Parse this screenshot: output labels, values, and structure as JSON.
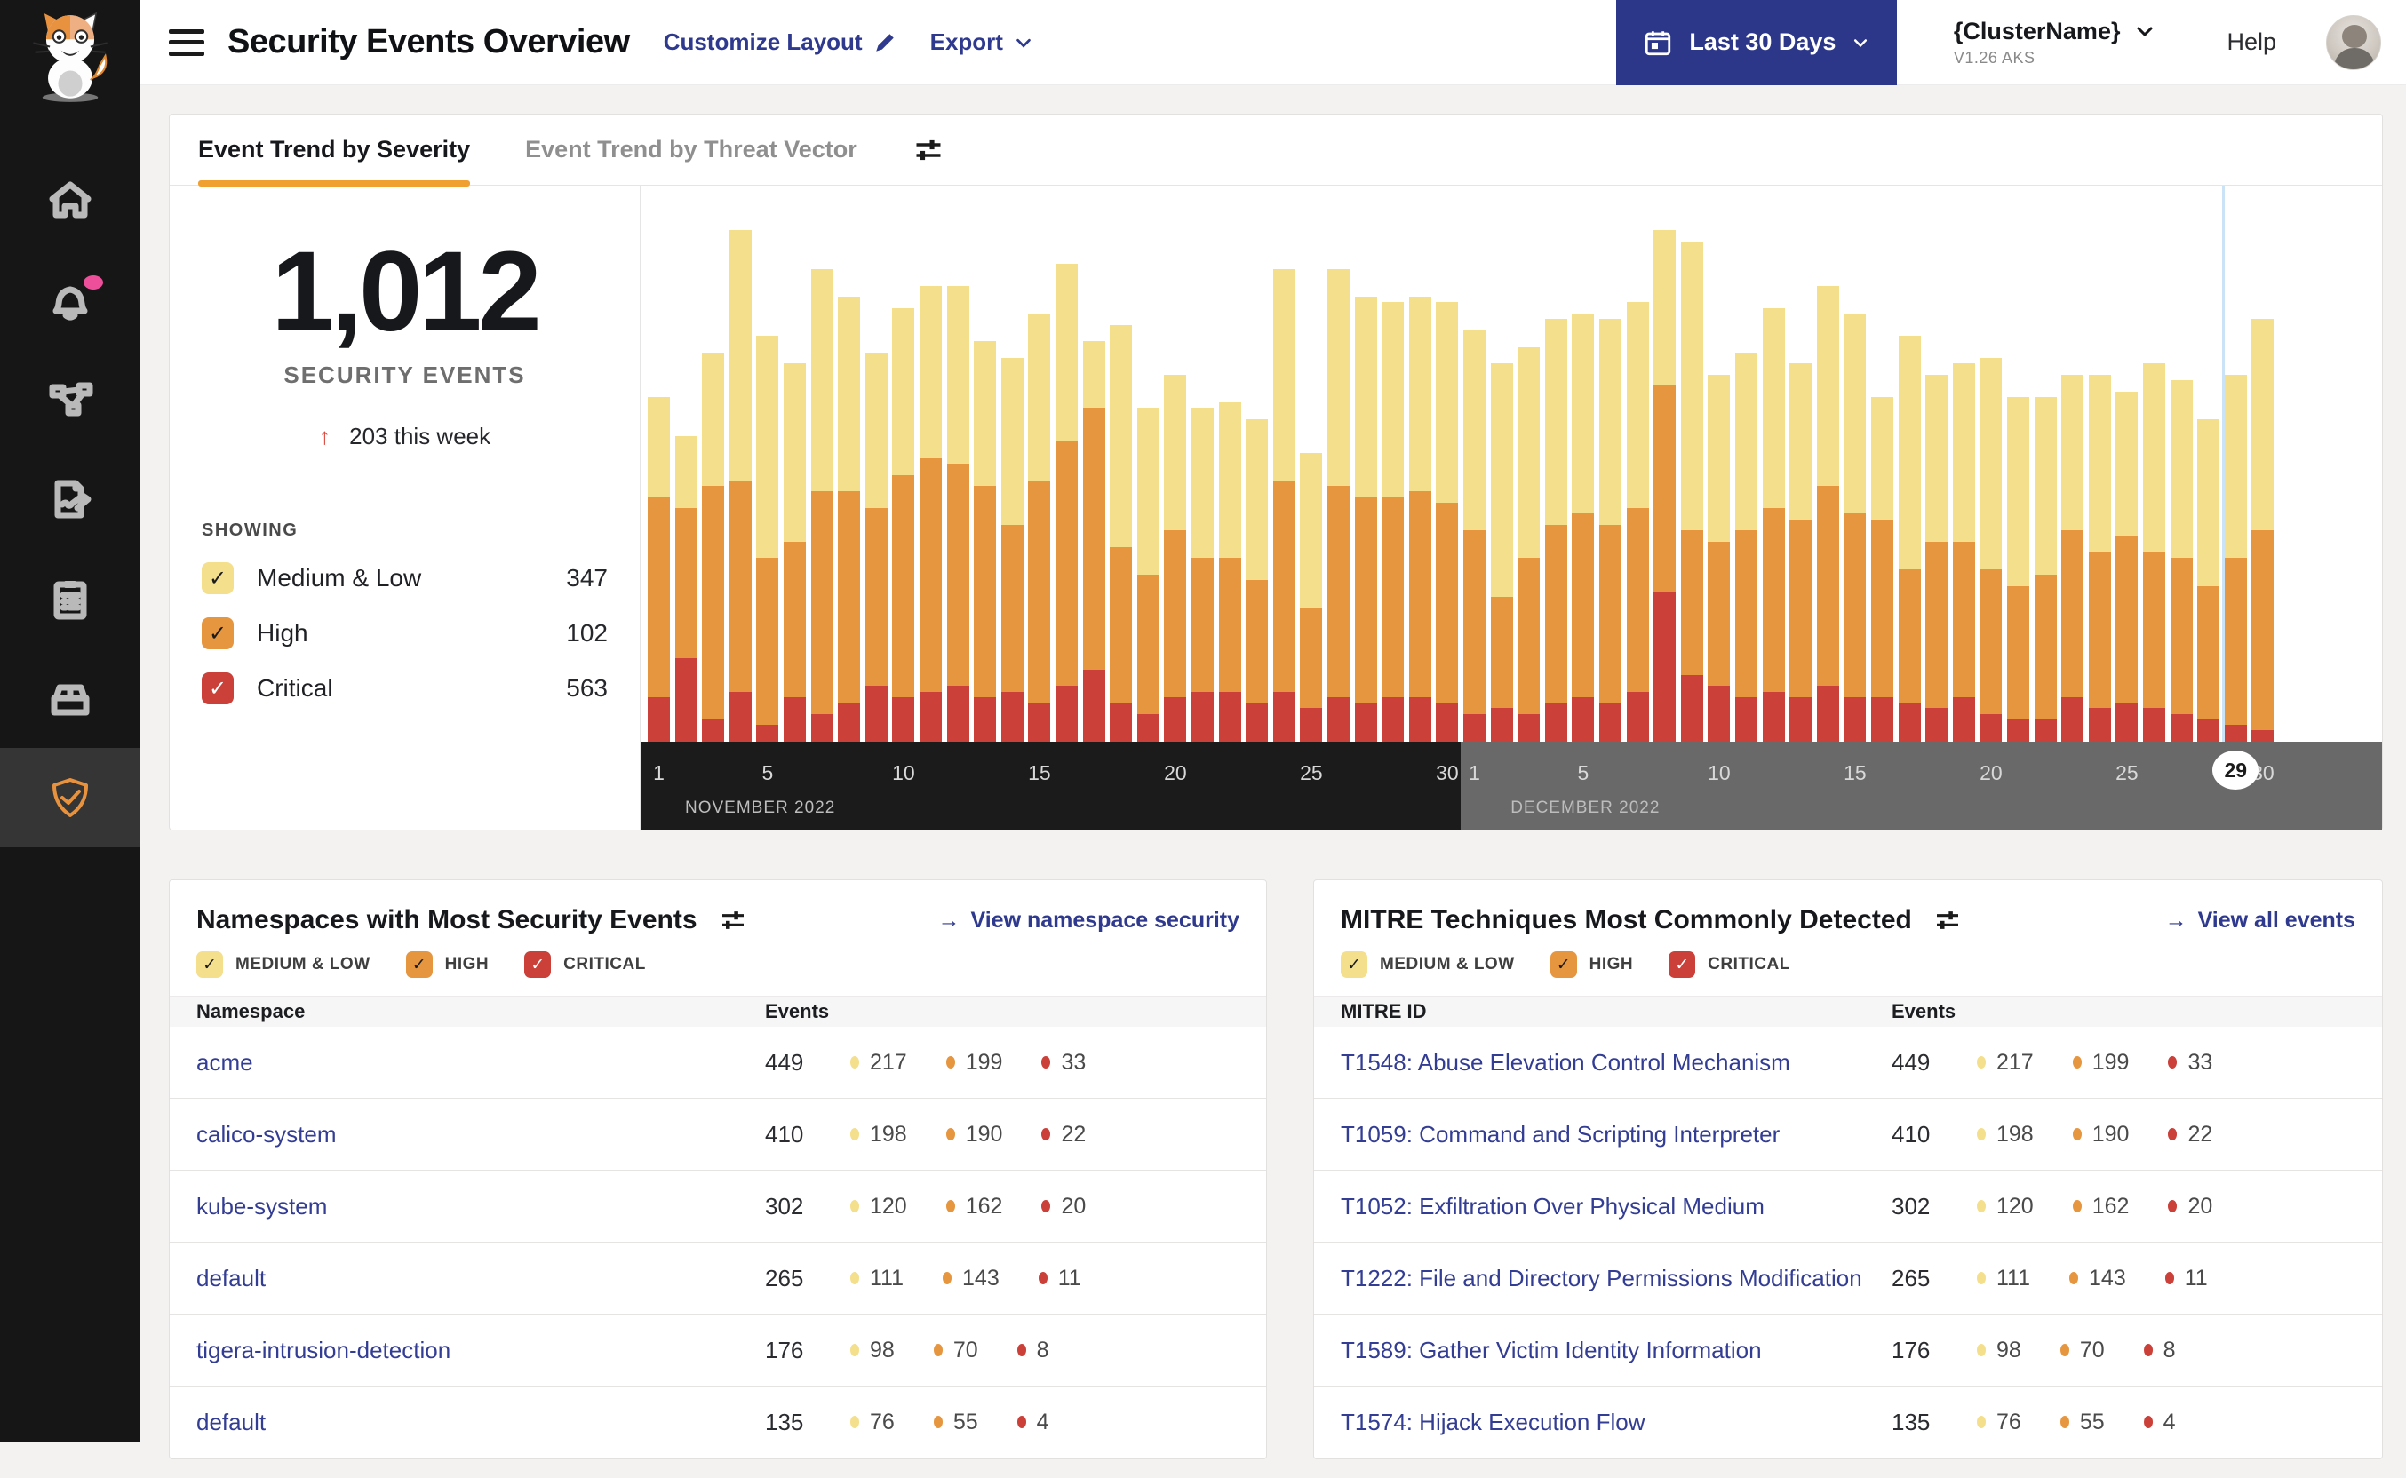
{
  "colors": {
    "accent_orange": "#F0A030",
    "navy_button": "#2D3789",
    "link_navy": "#333D94",
    "sev_medium_low": "#F4DF8C",
    "sev_high": "#E79640",
    "sev_critical": "#CB4039",
    "axis_november_bg": "#1B1B1B",
    "axis_december_bg": "#696969",
    "today_line_blue": "#CBE3F6",
    "alert_badge_pink": "#ED4F9B"
  },
  "sidebar": {
    "logo": "calico-cat-logo",
    "items": [
      {
        "name": "home",
        "active": false
      },
      {
        "name": "alerts",
        "active": false,
        "badge": true
      },
      {
        "name": "service-graph",
        "active": false
      },
      {
        "name": "policies",
        "active": false
      },
      {
        "name": "compliance",
        "active": false
      },
      {
        "name": "workloads",
        "active": false
      },
      {
        "name": "threat-defense",
        "active": true
      }
    ]
  },
  "header": {
    "title": "Security Events Overview",
    "customize_label": "Customize Layout",
    "export_label": "Export",
    "date_range_label": "Last 30 Days",
    "cluster_name": "{ClusterName}",
    "cluster_version": "V1.26 AKS",
    "help_label": "Help"
  },
  "severities": [
    {
      "key": "medium_low",
      "label": "Medium & Low",
      "legend_label": "MEDIUM & LOW",
      "color": "#F4DF8C",
      "check_color": "#1b1b1b"
    },
    {
      "key": "high",
      "label": "High",
      "legend_label": "HIGH",
      "color": "#E79640",
      "check_color": "#1b1b1b"
    },
    {
      "key": "critical",
      "label": "Critical",
      "legend_label": "CRITICAL",
      "color": "#CB4039",
      "check_color": "#ffffff"
    }
  ],
  "trend_card": {
    "tabs": [
      {
        "label": "Event Trend by Severity",
        "active": true
      },
      {
        "label": "Event Trend by Threat Vector",
        "active": false
      }
    ],
    "total_events": "1,012",
    "total_caption": "SECURITY EVENTS",
    "delta_arrow": "↑",
    "delta_text": "203 this week",
    "showing_label": "SHOWING",
    "showing_counts": {
      "medium_low": 347,
      "high": 102,
      "critical": 563
    }
  },
  "chart_data": {
    "type": "stacked-bar",
    "title": "Event Trend by Severity",
    "legend_position": "left-panel-checkboxes",
    "grid": false,
    "unit": "percent of plot height (estimated from pixels)",
    "x_axis": {
      "months": [
        {
          "label": "NOVEMBER 2022",
          "days": 30,
          "ticks": [
            1,
            5,
            10,
            15,
            20,
            25,
            30
          ]
        },
        {
          "label": "DECEMBER 2022",
          "days": 30,
          "ticks": [
            1,
            5,
            10,
            15,
            20,
            25,
            30
          ]
        }
      ],
      "today_marker": {
        "month_index": 1,
        "day": 29
      }
    },
    "series": [
      {
        "name": "Critical",
        "color": "#CB4039",
        "values": [
          8,
          15,
          4,
          9,
          3,
          8,
          5,
          7,
          10,
          8,
          9,
          10,
          8,
          9,
          7,
          10,
          13,
          7,
          5,
          8,
          9,
          9,
          7,
          9,
          6,
          8,
          7,
          8,
          8,
          7,
          5,
          6,
          5,
          7,
          8,
          7,
          9,
          27,
          12,
          10,
          8,
          9,
          8,
          10,
          8,
          8,
          7,
          6,
          8,
          5,
          4,
          4,
          8,
          6,
          7,
          6,
          5,
          4,
          3,
          2
        ]
      },
      {
        "name": "High",
        "color": "#E79640",
        "values": [
          36,
          27,
          42,
          38,
          30,
          28,
          40,
          38,
          32,
          40,
          42,
          40,
          38,
          30,
          40,
          44,
          47,
          28,
          25,
          30,
          24,
          24,
          22,
          38,
          18,
          38,
          37,
          36,
          37,
          36,
          33,
          20,
          28,
          32,
          33,
          32,
          33,
          37,
          26,
          26,
          30,
          33,
          32,
          36,
          33,
          32,
          24,
          30,
          28,
          26,
          24,
          26,
          30,
          28,
          30,
          28,
          28,
          24,
          30,
          36
        ]
      },
      {
        "name": "Medium & Low",
        "color": "#F4DF8C",
        "values": [
          18,
          13,
          24,
          45,
          40,
          32,
          40,
          35,
          28,
          30,
          31,
          32,
          26,
          30,
          30,
          32,
          12,
          40,
          30,
          28,
          27,
          28,
          29,
          38,
          28,
          39,
          36,
          35,
          35,
          36,
          36,
          42,
          38,
          37,
          36,
          37,
          37,
          28,
          52,
          30,
          32,
          36,
          28,
          36,
          36,
          22,
          42,
          30,
          32,
          38,
          34,
          32,
          28,
          32,
          26,
          34,
          32,
          30,
          33,
          38
        ]
      }
    ]
  },
  "namespace_card": {
    "title": "Namespaces with Most Security Events",
    "view_link": "View namespace security",
    "view_arrow": "→",
    "col_name": "Namespace",
    "col_events": "Events",
    "rows": [
      {
        "name": "acme",
        "total": "449",
        "medium_low": "217",
        "high": "199",
        "critical": "33"
      },
      {
        "name": "calico-system",
        "total": "410",
        "medium_low": "198",
        "high": "190",
        "critical": "22"
      },
      {
        "name": "kube-system",
        "total": "302",
        "medium_low": "120",
        "high": "162",
        "critical": "20"
      },
      {
        "name": "default",
        "total": "265",
        "medium_low": "111",
        "high": "143",
        "critical": "11"
      },
      {
        "name": "tigera-intrusion-detection",
        "total": "176",
        "medium_low": "98",
        "high": "70",
        "critical": "8"
      },
      {
        "name": "default",
        "total": "135",
        "medium_low": "76",
        "high": "55",
        "critical": "4"
      }
    ]
  },
  "mitre_card": {
    "title": "MITRE Techniques Most Commonly Detected",
    "view_link": "View all events",
    "view_arrow": "→",
    "col_name": "MITRE ID",
    "col_events": "Events",
    "rows": [
      {
        "name": "T1548: Abuse Elevation Control Mechanism",
        "total": "449",
        "medium_low": "217",
        "high": "199",
        "critical": "33"
      },
      {
        "name": "T1059: Command and Scripting Interpreter",
        "total": "410",
        "medium_low": "198",
        "high": "190",
        "critical": "22"
      },
      {
        "name": "T1052: Exfiltration Over Physical Medium",
        "total": "302",
        "medium_low": "120",
        "high": "162",
        "critical": "20"
      },
      {
        "name": "T1222: File and Directory Permissions Modification",
        "total": "265",
        "medium_low": "111",
        "high": "143",
        "critical": "11"
      },
      {
        "name": "T1589: Gather Victim Identity Information",
        "total": "176",
        "medium_low": "98",
        "high": "70",
        "critical": "8"
      },
      {
        "name": "T1574: Hijack Execution Flow",
        "total": "135",
        "medium_low": "76",
        "high": "55",
        "critical": "4"
      }
    ]
  }
}
